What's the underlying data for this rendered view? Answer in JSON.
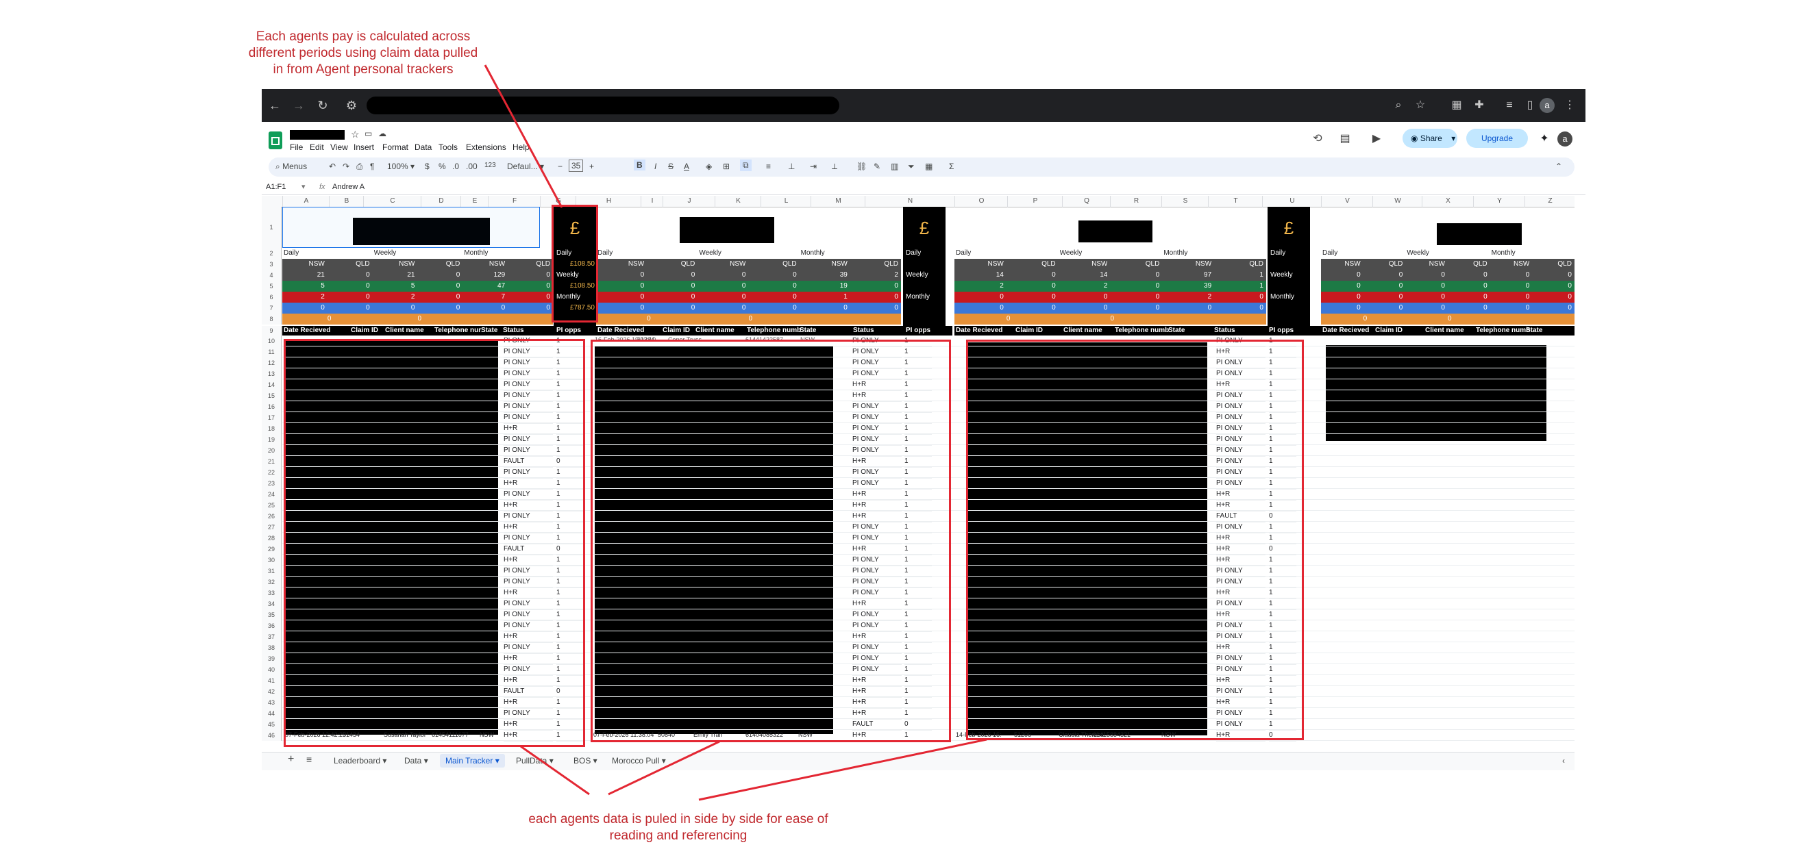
{
  "annotations": {
    "top_note": "Each agents pay is calculated across different periods using claim data pulled in from Agent personal trackers",
    "bottom_note": "each agents data is puled in side by side for ease of reading and referencing"
  },
  "browser": {
    "avatar": "a"
  },
  "menus": [
    "File",
    "Edit",
    "View",
    "Insert",
    "Format",
    "Data",
    "Tools",
    "Extensions",
    "Help"
  ],
  "toolbar": {
    "search": "Menus",
    "zoom": "100%",
    "currency": "$",
    "percent": "%",
    "dec_less": ".0",
    "dec_more": ".00",
    "num_fmt": "123",
    "font": "Defaul...",
    "minus": "−",
    "font_size": "35",
    "plus": "+",
    "bold": "B",
    "italic": "I",
    "strike": "S",
    "text_color": "A",
    "sum": "Σ"
  },
  "actions": {
    "share": "Share",
    "upgrade": "Upgrade",
    "avatar": "a"
  },
  "formula_bar": {
    "ref": "A1:F1",
    "fx": "fx",
    "value": "Andrew A"
  },
  "columns": [
    "A",
    "B",
    "C",
    "D",
    "E",
    "F",
    "G",
    "H",
    "I",
    "J",
    "K",
    "L",
    "M",
    "N",
    "O",
    "P",
    "Q",
    "R",
    "S",
    "T",
    "U",
    "V",
    "W",
    "X",
    "Y",
    "Z"
  ],
  "pay_panel": {
    "symbol": "£",
    "daily": "Daily",
    "daily_value": "£108.50",
    "weekly": "Weekly",
    "weekly_value": "£108.50",
    "monthly": "Monthly",
    "monthly_value": "£787.50"
  },
  "pay_panel_2": {
    "symbol": "£",
    "daily": "Daily",
    "weekly": "Weekly",
    "monthly": "Monthly"
  },
  "pay_panel_3": {
    "symbol": "£",
    "daily": "Daily",
    "weekly": "Weekly",
    "monthly": "Monthly"
  },
  "period_labels": {
    "daily": "Daily",
    "weekly": "Weekly",
    "monthly": "Monthly"
  },
  "state_labels": {
    "nsw": "NSW",
    "qld": "QLD"
  },
  "agent_blocks": [
    {
      "rows": [
        [
          "21",
          "0",
          "21",
          "0",
          "129",
          "0"
        ],
        [
          "5",
          "0",
          "5",
          "0",
          "47",
          "0"
        ],
        [
          "2",
          "0",
          "2",
          "0",
          "7",
          "0"
        ],
        [
          "0",
          "0",
          "0",
          "0",
          "0",
          "0"
        ]
      ],
      "orange": [
        "0",
        "0"
      ]
    },
    {
      "rows": [
        [
          "0",
          "0",
          "0",
          "0",
          "39",
          "2"
        ],
        [
          "0",
          "0",
          "0",
          "0",
          "19",
          "0"
        ],
        [
          "0",
          "0",
          "0",
          "0",
          "1",
          "0"
        ],
        [
          "0",
          "0",
          "0",
          "0",
          "0",
          "0"
        ]
      ],
      "orange": [
        "0",
        "0"
      ]
    },
    {
      "rows": [
        [
          "14",
          "0",
          "14",
          "0",
          "97",
          "1"
        ],
        [
          "2",
          "0",
          "2",
          "0",
          "39",
          "1"
        ],
        [
          "0",
          "0",
          "0",
          "0",
          "2",
          "0"
        ],
        [
          "0",
          "0",
          "0",
          "0",
          "0",
          "0"
        ]
      ],
      "orange": [
        "0",
        "0"
      ]
    },
    {
      "rows": [
        [
          "0",
          "0",
          "0",
          "0",
          "0",
          "0"
        ],
        [
          "0",
          "0",
          "0",
          "0",
          "0",
          "0"
        ],
        [
          "0",
          "0",
          "0",
          "0",
          "0",
          "0"
        ],
        [
          "0",
          "0",
          "0",
          "0",
          "0",
          "0"
        ]
      ],
      "orange": [
        "0",
        "0"
      ]
    }
  ],
  "table_headers": {
    "a1": [
      "Date Recieved",
      "Claim ID",
      "Client name",
      "Telephone nur",
      "State",
      "Status",
      "PI opps"
    ],
    "a2": [
      "Date Recieved",
      "Claim ID",
      "Client name",
      "Telephone numb",
      "State",
      "Status",
      "PI opps"
    ],
    "a3": [
      "Date Recieved",
      "Claim ID",
      "Client name",
      "Telephone numb",
      "State",
      "Status",
      "PI opps"
    ],
    "a4": [
      "Date Recieved",
      "Claim ID",
      "Client name",
      "Telephone numb",
      "State"
    ]
  },
  "row_numbers": [
    "1",
    "2",
    "3",
    "4",
    "5",
    "6",
    "7",
    "8",
    "9",
    "10",
    "11",
    "12",
    "13",
    "14",
    "15",
    "16",
    "17",
    "18",
    "19",
    "20",
    "21",
    "22",
    "23",
    "24",
    "25",
    "26",
    "27",
    "28",
    "29",
    "30",
    "31",
    "32",
    "33",
    "34",
    "35",
    "36",
    "37",
    "38",
    "39",
    "40",
    "41",
    "42",
    "43",
    "44",
    "45",
    "46"
  ],
  "agent1_status": [
    [
      "PI ONLY",
      "1"
    ],
    [
      "PI ONLY",
      "1"
    ],
    [
      "PI ONLY",
      "1"
    ],
    [
      "PI ONLY",
      "1"
    ],
    [
      "PI ONLY",
      "1"
    ],
    [
      "PI ONLY",
      "1"
    ],
    [
      "PI ONLY",
      "1"
    ],
    [
      "PI ONLY",
      "1"
    ],
    [
      "H+R",
      "1"
    ],
    [
      "PI ONLY",
      "1"
    ],
    [
      "PI ONLY",
      "1"
    ],
    [
      "FAULT",
      "0"
    ],
    [
      "PI ONLY",
      "1"
    ],
    [
      "H+R",
      "1"
    ],
    [
      "PI ONLY",
      "1"
    ],
    [
      "H+R",
      "1"
    ],
    [
      "PI ONLY",
      "1"
    ],
    [
      "H+R",
      "1"
    ],
    [
      "PI ONLY",
      "1"
    ],
    [
      "FAULT",
      "0"
    ],
    [
      "H+R",
      "1"
    ],
    [
      "PI ONLY",
      "1"
    ],
    [
      "PI ONLY",
      "1"
    ],
    [
      "H+R",
      "1"
    ],
    [
      "PI ONLY",
      "1"
    ],
    [
      "PI ONLY",
      "1"
    ],
    [
      "PI ONLY",
      "1"
    ],
    [
      "H+R",
      "1"
    ],
    [
      "PI ONLY",
      "1"
    ],
    [
      "H+R",
      "1"
    ],
    [
      "PI ONLY",
      "1"
    ],
    [
      "H+R",
      "1"
    ],
    [
      "FAULT",
      "0"
    ],
    [
      "H+R",
      "1"
    ],
    [
      "PI ONLY",
      "1"
    ],
    [
      "H+R",
      "1"
    ],
    [
      "H+R",
      "1"
    ]
  ],
  "agent2_status": [
    [
      "PI ONLY",
      "1"
    ],
    [
      "PI ONLY",
      "1"
    ],
    [
      "PI ONLY",
      "1"
    ],
    [
      "PI ONLY",
      "1"
    ],
    [
      "H+R",
      "1"
    ],
    [
      "H+R",
      "1"
    ],
    [
      "PI ONLY",
      "1"
    ],
    [
      "PI ONLY",
      "1"
    ],
    [
      "PI ONLY",
      "1"
    ],
    [
      "PI ONLY",
      "1"
    ],
    [
      "PI ONLY",
      "1"
    ],
    [
      "H+R",
      "1"
    ],
    [
      "PI ONLY",
      "1"
    ],
    [
      "PI ONLY",
      "1"
    ],
    [
      "H+R",
      "1"
    ],
    [
      "H+R",
      "1"
    ],
    [
      "H+R",
      "1"
    ],
    [
      "PI ONLY",
      "1"
    ],
    [
      "PI ONLY",
      "1"
    ],
    [
      "H+R",
      "1"
    ],
    [
      "PI ONLY",
      "1"
    ],
    [
      "PI ONLY",
      "1"
    ],
    [
      "PI ONLY",
      "1"
    ],
    [
      "PI ONLY",
      "1"
    ],
    [
      "H+R",
      "1"
    ],
    [
      "PI ONLY",
      "1"
    ],
    [
      "PI ONLY",
      "1"
    ],
    [
      "H+R",
      "1"
    ],
    [
      "PI ONLY",
      "1"
    ],
    [
      "PI ONLY",
      "1"
    ],
    [
      "PI ONLY",
      "1"
    ],
    [
      "H+R",
      "1"
    ],
    [
      "H+R",
      "1"
    ],
    [
      "H+R",
      "1"
    ],
    [
      "H+R",
      "1"
    ],
    [
      "FAULT",
      "0"
    ],
    [
      "H+R",
      "1"
    ]
  ],
  "agent3_status": [
    [
      "PI ONLY",
      "1"
    ],
    [
      "H+R",
      "1"
    ],
    [
      "PI ONLY",
      "1"
    ],
    [
      "PI ONLY",
      "1"
    ],
    [
      "H+R",
      "1"
    ],
    [
      "PI ONLY",
      "1"
    ],
    [
      "PI ONLY",
      "1"
    ],
    [
      "PI ONLY",
      "1"
    ],
    [
      "PI ONLY",
      "1"
    ],
    [
      "PI ONLY",
      "1"
    ],
    [
      "PI ONLY",
      "1"
    ],
    [
      "PI ONLY",
      "1"
    ],
    [
      "PI ONLY",
      "1"
    ],
    [
      "PI ONLY",
      "1"
    ],
    [
      "H+R",
      "1"
    ],
    [
      "H+R",
      "1"
    ],
    [
      "FAULT",
      "0"
    ],
    [
      "PI ONLY",
      "1"
    ],
    [
      "H+R",
      "1"
    ],
    [
      "H+R",
      "0"
    ],
    [
      "H+R",
      "1"
    ],
    [
      "PI ONLY",
      "1"
    ],
    [
      "PI ONLY",
      "1"
    ],
    [
      "H+R",
      "1"
    ],
    [
      "PI ONLY",
      "1"
    ],
    [
      "H+R",
      "1"
    ],
    [
      "PI ONLY",
      "1"
    ],
    [
      "PI ONLY",
      "1"
    ],
    [
      "H+R",
      "1"
    ],
    [
      "PI ONLY",
      "1"
    ],
    [
      "PI ONLY",
      "1"
    ],
    [
      "H+R",
      "1"
    ],
    [
      "PI ONLY",
      "1"
    ],
    [
      "H+R",
      "1"
    ],
    [
      "PI ONLY",
      "1"
    ],
    [
      "PI ONLY",
      "1"
    ],
    [
      "H+R",
      "0"
    ]
  ],
  "last_row": {
    "agent1": [
      "07-Feb-2026 12:42:29",
      "51434",
      "Susanah Taylor",
      "61454111677",
      "NSW"
    ],
    "agent2": [
      "07-Feb-2026 11:38:04",
      "50840",
      "Emily Tran",
      "61404085322",
      "NSW"
    ],
    "agent3": [
      "14-Feb-2026 16:",
      "51206",
      "Claudia Theresa",
      "61415884321",
      "NSW"
    ]
  },
  "row10_agent2": [
    "16-Feb-2026 19:03:10",
    "51284",
    "Conor Truss",
    "61441422587",
    "NSW"
  ],
  "sheet_tabs": [
    "Leaderboard",
    "Data",
    "Main Tracker",
    "PullData",
    "BOS",
    "Morocco Pull"
  ],
  "active_tab": "Main Tracker",
  "tab_controls": {
    "add": "+",
    "list": "≡",
    "nav": "‹"
  }
}
